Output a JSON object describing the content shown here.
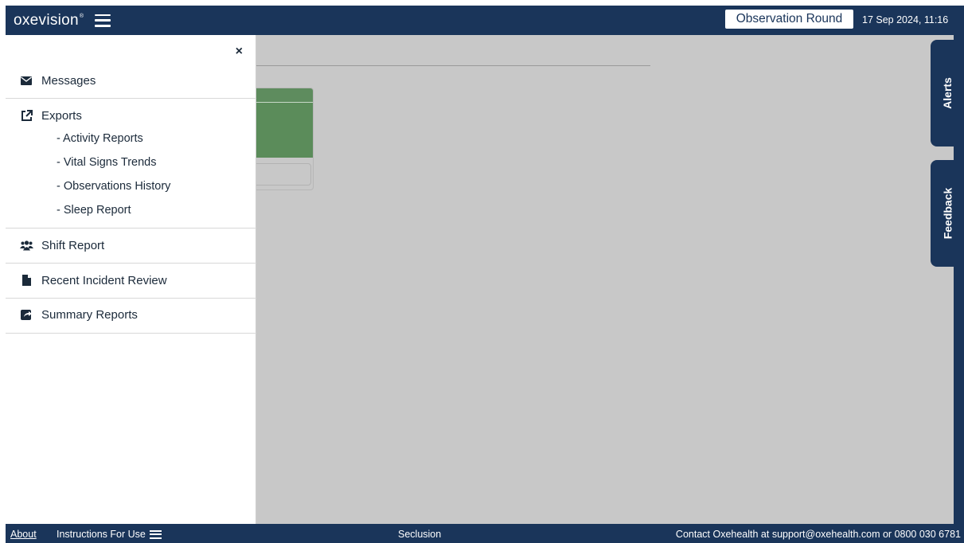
{
  "header": {
    "logo_text": "oxevision",
    "logo_mark": "®",
    "observation_round_label": "Observation Round",
    "datetime": "17 Sep 2024, 11:16"
  },
  "drawer": {
    "close_label": "×",
    "items": [
      {
        "label": "Messages",
        "icon": "envelope-icon"
      },
      {
        "label": "Exports",
        "icon": "external-link-icon",
        "sub_items": [
          "- Activity Reports",
          "- Vital Signs Trends",
          "- Observations History",
          "- Sleep Report"
        ]
      },
      {
        "label": "Shift Report",
        "icon": "users-icon"
      },
      {
        "label": "Recent Incident Review",
        "icon": "file-icon"
      },
      {
        "label": "Summary Reports",
        "icon": "share-icon"
      }
    ]
  },
  "side_tabs": {
    "alerts": "Alerts",
    "feedback": "Feedback"
  },
  "footer": {
    "about": "About",
    "instructions": "Instructions For Use",
    "center": "Seclusion",
    "contact": "Contact Oxehealth at support@oxehealth.com or 0800 030 6781"
  },
  "colors": {
    "navy": "#1a355a",
    "card_green": "#5b8c5a",
    "overlay_grey": "#c8c8c8"
  }
}
